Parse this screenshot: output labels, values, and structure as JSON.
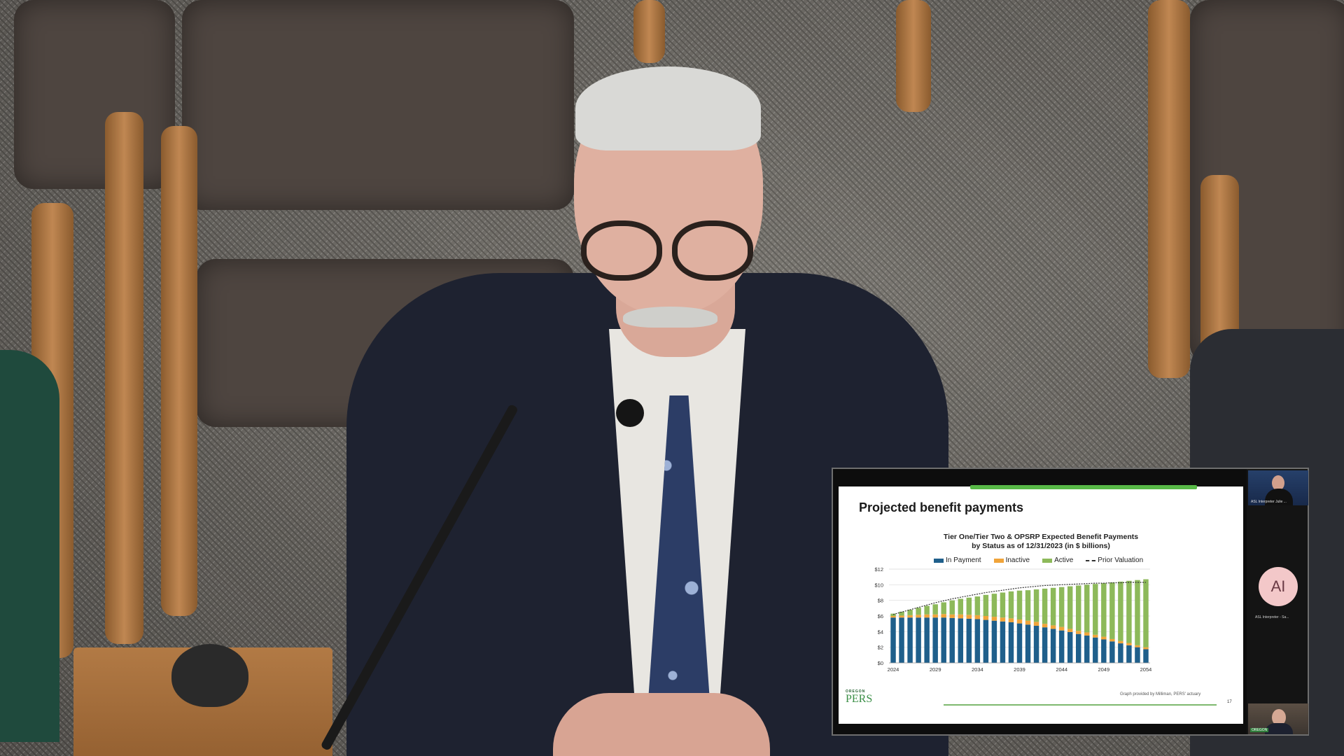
{
  "slide": {
    "title": "Projected benefit payments",
    "top_bar_label": "",
    "source_note": "Graph provided by Milliman, PERS' actuary",
    "page_number": "17",
    "logo": {
      "top": "OREGON",
      "main": "PERS"
    }
  },
  "chart_data": {
    "type": "bar",
    "title": "Tier One/Tier Two & OPSRP Expected Benefit Payments",
    "subtitle": "by Status as of 12/31/2023 (in $ billions)",
    "xlabel": "",
    "ylabel": "",
    "ylim": [
      0,
      12
    ],
    "y_ticks": [
      "$0",
      "$2",
      "$4",
      "$6",
      "$8",
      "$10",
      "$12"
    ],
    "x_tick_labels": [
      "2024",
      "2029",
      "2034",
      "2039",
      "2044",
      "2049",
      "2054"
    ],
    "stacked": true,
    "legend_position": "top",
    "grid": true,
    "categories": [
      2024,
      2025,
      2026,
      2027,
      2028,
      2029,
      2030,
      2031,
      2032,
      2033,
      2034,
      2035,
      2036,
      2037,
      2038,
      2039,
      2040,
      2041,
      2042,
      2043,
      2044,
      2045,
      2046,
      2047,
      2048,
      2049,
      2050,
      2051,
      2052,
      2053,
      2054
    ],
    "series": [
      {
        "name": "In Payment",
        "color": "#1f5f8b",
        "values": [
          5.8,
          5.8,
          5.8,
          5.8,
          5.8,
          5.8,
          5.8,
          5.75,
          5.7,
          5.65,
          5.6,
          5.5,
          5.4,
          5.3,
          5.2,
          5.05,
          4.9,
          4.75,
          4.55,
          4.35,
          4.15,
          3.95,
          3.7,
          3.5,
          3.25,
          3.0,
          2.75,
          2.5,
          2.25,
          2.0,
          1.75
        ]
      },
      {
        "name": "Inactive",
        "color": "#f0a43a",
        "values": [
          0.2,
          0.25,
          0.3,
          0.35,
          0.4,
          0.4,
          0.45,
          0.45,
          0.5,
          0.5,
          0.5,
          0.5,
          0.5,
          0.5,
          0.5,
          0.5,
          0.5,
          0.5,
          0.45,
          0.45,
          0.45,
          0.4,
          0.4,
          0.4,
          0.35,
          0.35,
          0.3,
          0.3,
          0.3,
          0.25,
          0.25
        ]
      },
      {
        "name": "Active",
        "color": "#8db95a",
        "values": [
          0.3,
          0.5,
          0.7,
          0.9,
          1.1,
          1.3,
          1.5,
          1.8,
          2.0,
          2.2,
          2.4,
          2.7,
          2.95,
          3.2,
          3.45,
          3.7,
          3.9,
          4.15,
          4.5,
          4.8,
          5.1,
          5.45,
          5.8,
          6.1,
          6.5,
          6.85,
          7.25,
          7.6,
          7.95,
          8.35,
          8.7
        ]
      }
    ],
    "prior_valuation": {
      "name": "Prior Valuation",
      "style": "dashed",
      "values": [
        6.2,
        6.5,
        6.8,
        7.1,
        7.4,
        7.7,
        7.95,
        8.2,
        8.4,
        8.6,
        8.8,
        9.0,
        9.15,
        9.3,
        9.45,
        9.6,
        9.7,
        9.8,
        9.9,
        9.95,
        10.0,
        10.05,
        10.1,
        10.15,
        10.2,
        10.2,
        10.25,
        10.25,
        10.3,
        10.3,
        10.3
      ]
    }
  },
  "sidebar": {
    "interpreter_tile_label": "ASL Interpreter Julie ...",
    "avatar_initials": "AI",
    "avatar_label": "ASL Interpreter - Sa...",
    "room_badge": "OREGON"
  }
}
